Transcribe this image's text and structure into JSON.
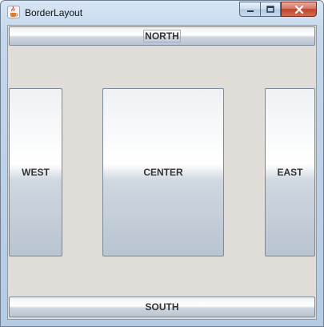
{
  "window": {
    "title": "BorderLayout",
    "app_icon": "java-cup-icon",
    "controls": {
      "minimize_icon": "minimize-icon",
      "maximize_icon": "maximize-icon",
      "close_icon": "close-icon"
    }
  },
  "buttons": {
    "north": "NORTH",
    "south": "SOUTH",
    "west": "WEST",
    "center": "CENTER",
    "east": "EAST"
  },
  "colors": {
    "content_background": "#e0ddd9",
    "close_button": "#c2442b"
  }
}
